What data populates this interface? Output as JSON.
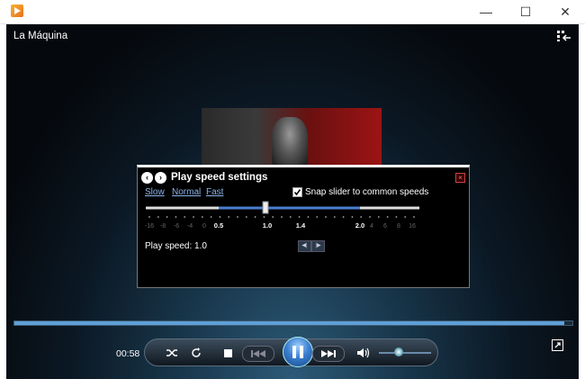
{
  "window": {
    "title_icon": "media-player-app-icon",
    "controls": {
      "minimize": "—",
      "maximize": "☐",
      "close": "✕"
    }
  },
  "now_playing": {
    "track_title": "La Máquina"
  },
  "speed_panel": {
    "title": "Play speed settings",
    "presets": {
      "slow": "Slow",
      "normal": "Normal",
      "fast": "Fast"
    },
    "snap_label": "Snap slider to common speeds",
    "snap_checked": true,
    "speed_readout": "Play speed: 1.0",
    "slider_value": 1.0,
    "ticks_dim_left": [
      "-16",
      "-8",
      "-6",
      "-4",
      "0"
    ],
    "ticks_main": [
      "0.5",
      "1.0",
      "1.4",
      "2.0"
    ],
    "ticks_dim_right": [
      "4",
      "6",
      "8",
      "16"
    ]
  },
  "playback": {
    "elapsed": "00:58",
    "progress": 0.985,
    "volume": 0.5,
    "state": "playing"
  },
  "colors": {
    "accent": "#5fa0d8",
    "panel_bg": "#000000",
    "link": "#8ab4e8"
  }
}
